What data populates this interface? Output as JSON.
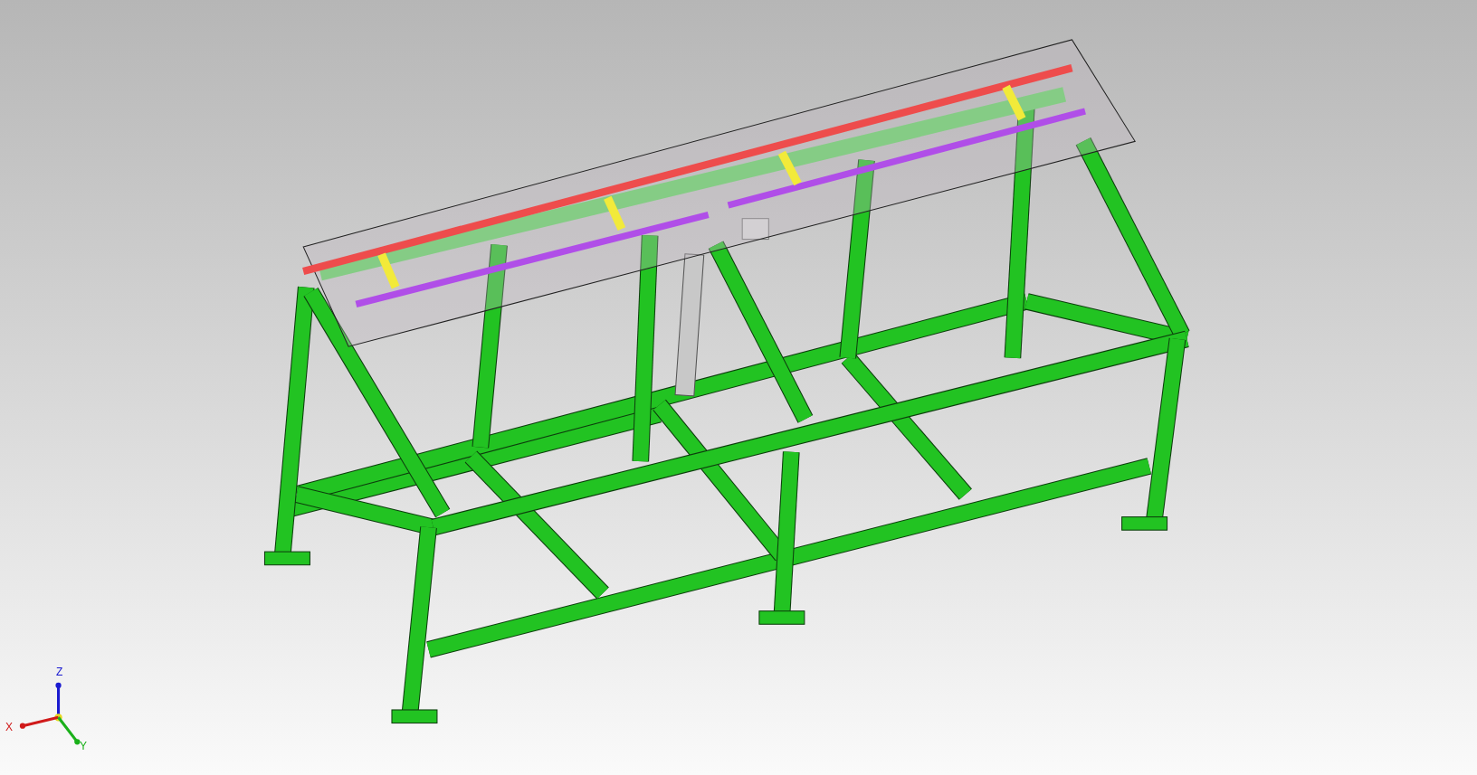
{
  "viewport": {
    "axis_triad": {
      "axes": [
        {
          "kind": "z",
          "label": "Z",
          "color": "#1a1ad0"
        },
        {
          "kind": "x",
          "label": "X",
          "color": "#d01a1a"
        },
        {
          "kind": "y",
          "label": "Y",
          "color": "#1ab01a"
        }
      ]
    }
  }
}
